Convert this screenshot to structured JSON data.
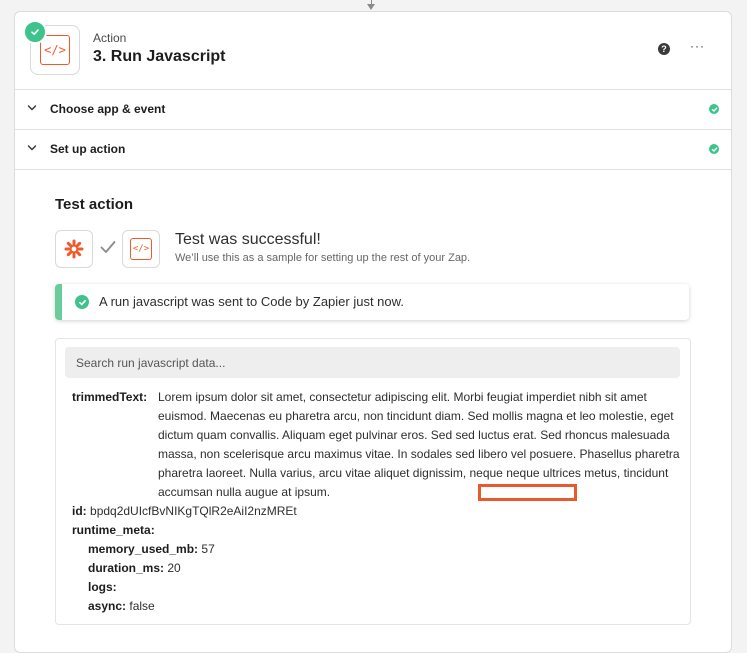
{
  "step": {
    "kind": "Action",
    "title": "3. Run Javascript",
    "code_glyph": "</>",
    "help_glyph": "?",
    "more_glyph": "···"
  },
  "sections": [
    {
      "label": "Choose app & event"
    },
    {
      "label": "Set up action"
    }
  ],
  "test": {
    "title": "Test action",
    "success_title": "Test was successful!",
    "success_subtitle": "We’ll use this as a sample for setting up the rest of your Zap.",
    "alert": "A run javascript was sent to Code by Zapier just now."
  },
  "data_panel": {
    "search_placeholder": "Search run javascript data...",
    "trimmedText_key": "trimmedText:",
    "trimmedText_value": "Lorem ipsum dolor sit amet, consectetur adipiscing elit. Morbi feugiat imperdiet nibh sit amet euismod. Maecenas eu pharetra arcu, non tincidunt diam. Sed mollis magna et leo molestie, eget dictum quam convallis. Aliquam eget pulvinar eros. Sed sed luctus erat. Sed rhoncus malesuada massa, non scelerisque arcu maximus vitae. In sodales sed libero vel posuere. Phasellus pharetra pharetra laoreet. Nulla varius, arcu vitae aliquet dignissim, neque neque ultrices metus, tincidunt accumsan nulla augue at ipsum.",
    "id_key": "id:",
    "id_value": "bpdq2dUIcfBvNIKgTQlR2eAiI2nzMREt",
    "runtime_meta_key": "runtime_meta:",
    "memory_key": "memory_used_mb:",
    "memory_value": "57",
    "duration_key": "duration_ms:",
    "duration_value": "20",
    "logs_key": "logs:",
    "async_key": "async:",
    "async_value": "false"
  },
  "colors": {
    "accent": "#ef5a2a",
    "success": "#3fc38d",
    "highlight": "#e85a2b"
  }
}
